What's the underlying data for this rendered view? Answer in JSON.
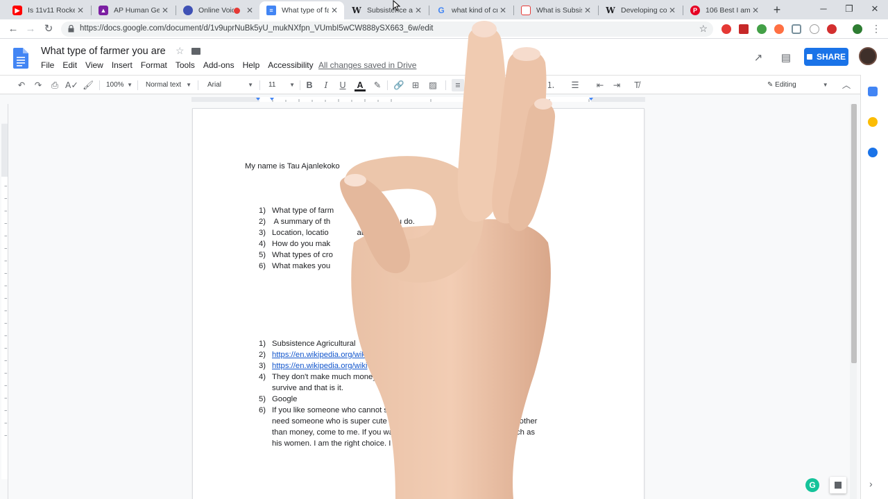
{
  "browser": {
    "tabs": [
      {
        "title": "Is 11v11 Rocket",
        "icon": "youtube-icon",
        "color": "#ff0000"
      },
      {
        "title": "AP Human Geog",
        "icon": "classroom-icon",
        "color": "#7b1fa2"
      },
      {
        "title": "Online Voice",
        "icon": "voice-recorder-icon",
        "color": "#3f51b5"
      },
      {
        "title": "What type of far",
        "icon": "google-docs-icon",
        "color": "#4285f4",
        "active": true
      },
      {
        "title": "Subsistence agri",
        "icon": "wikipedia-icon",
        "color": "#5f6368"
      },
      {
        "title": "what kind of cro",
        "icon": "google-icon",
        "color": "#4285f4"
      },
      {
        "title": "What is Subsist",
        "icon": "site-icon",
        "color": "#e53935"
      },
      {
        "title": "Developing cou",
        "icon": "wikipedia-icon",
        "color": "#5f6368"
      },
      {
        "title": "106 Best I am a",
        "icon": "pinterest-icon",
        "color": "#e60023"
      }
    ],
    "url": "https://docs.google.com/document/d/1v9uprNuBk5yU_mukNXfpn_VUmbI5wCW888ySX663_6w/edit"
  },
  "docs": {
    "title": "What type of farmer you are",
    "menu": [
      "File",
      "Edit",
      "View",
      "Insert",
      "Format",
      "Tools",
      "Add-ons",
      "Help",
      "Accessibility"
    ],
    "saved_status": "All changes saved in Drive",
    "share_label": "SHARE",
    "zoom": "100%",
    "style": "Normal text",
    "font": "Arial",
    "font_size": "11",
    "mode": "Editing"
  },
  "document": {
    "intro": "My name is Tau Ajanlekoko",
    "list1": [
      {
        "num": "1)",
        "text": "What type of farm            e."
      },
      {
        "num": "2)",
        "text": " A summary of th               arming you do."
      },
      {
        "num": "3)",
        "text": "Location, locatio             ation: Where you an                                   ated?"
      },
      {
        "num": "4)",
        "text": "How do you mak                oney? Do you make"
      },
      {
        "num": "5)",
        "text": "What types of cro              farm?"
      },
      {
        "num": "6)",
        "text": "What makes you                 h?"
      }
    ],
    "list2": [
      {
        "num": "1)",
        "text": "Subsistence Agricultural",
        "link": false
      },
      {
        "num": "2)",
        "text": "https://en.wikipedia.org/wik",
        "link": true
      },
      {
        "num": "3)",
        "text": "https://en.wikipedia.org/wiki",
        "link": true
      },
      {
        "num": "4)",
        "text": "They don't make much money                               ow what they need to",
        "link": false
      },
      {
        "num": "",
        "text": "survive and that is it.",
        "link": false
      },
      {
        "num": "5)",
        "text": "Google",
        "link": false
      },
      {
        "num": "6)",
        "text": "If you like someone who cannot sup                          am the man. If you",
        "link": false
      },
      {
        "num": "",
        "text": "need someone who is super cute and                           ood for anything other",
        "link": false
      },
      {
        "num": "",
        "text": "than money, come to me. If you want s                         tomatoes as much as",
        "link": false
      },
      {
        "num": "",
        "text": "his women. I am the right choice. I ain'                        I am the catch.",
        "link": false
      }
    ]
  },
  "colors": {
    "accent": "#1a73e8",
    "link": "#1155cc"
  }
}
